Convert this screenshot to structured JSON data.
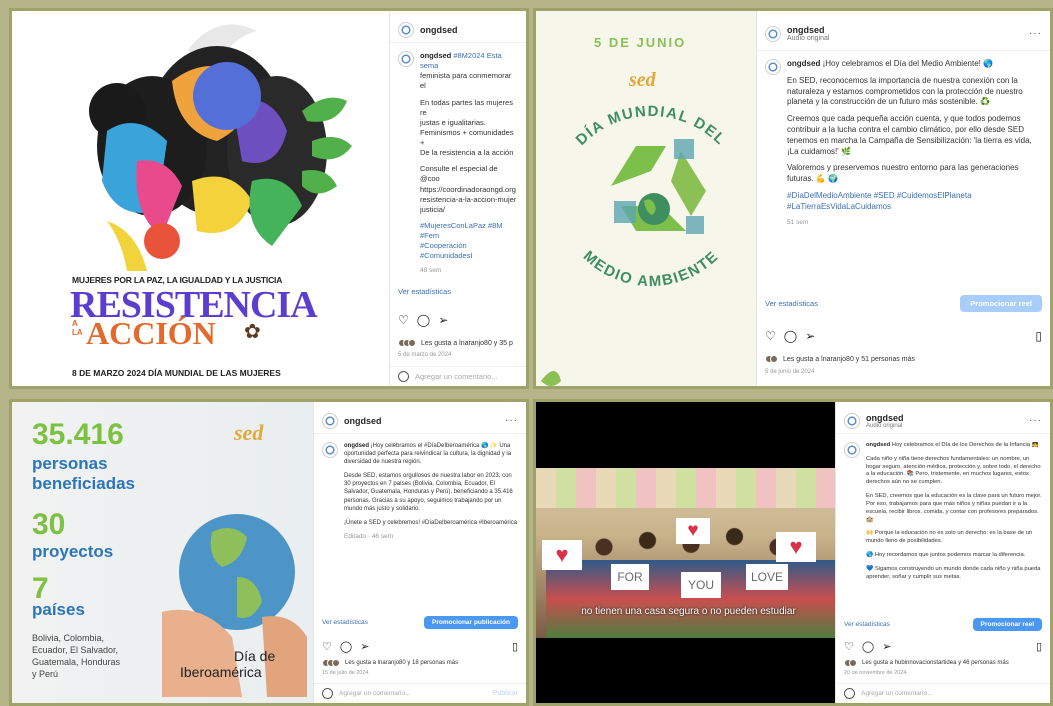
{
  "post1": {
    "username": "ongdsed",
    "caption_user": "ongdsed",
    "caption_lines": [
      "#8M2024 Esta sema",
      "feminista para conmemorar el"
    ],
    "caption_p2": [
      "En todas partes las mujeres re",
      "justas e igualitarias.",
      "Feminismos + comunidades +",
      "De la resistencia a la acción"
    ],
    "caption_p3": [
      "Consulte el especial de @coo",
      "https://coordinadoraongd.org",
      "resistencia-a-la-accion-mujer",
      "justicia/"
    ],
    "tags": [
      "#MujeresConLaPaz #8M #Fem",
      "#Cooperación #ComunidadesI"
    ],
    "time": "48 sem",
    "stats_link": "Ver estadísticas",
    "likes_text": "Les gusta a lnaranjo80 y 35 p",
    "date": "5 de marzo de 2024",
    "comment_placeholder": "Agregar un comentario...",
    "image": {
      "line1": "MUJERES POR LA PAZ, LA IGUALDAD Y LA JUSTICIA",
      "title1": "RESISTENCIA",
      "prefix": "A LA",
      "title2": "ACCIÓN",
      "footer": "8 DE MARZO 2024 DÍA MUNDIAL DE LAS MUJERES"
    }
  },
  "post2": {
    "username": "ongdsed",
    "audio": "Audio original",
    "caption_user": "ongdsed",
    "caption_first": "¡Hoy celebramos el Día del Medio Ambiente! 🌎",
    "caption_p2": "En SED, reconocemos la importancia de nuestra conexión con la naturaleza y estamos comprometidos con la protección de nuestro planeta y la construcción de un futuro más sostenible. ♻️",
    "caption_p3": "Creemos que cada pequeña acción cuenta, y que todos podemos contribuir a la lucha contra el cambio climático, por ello desde SED tenemos en marcha la Campaña de Sensibilización: 'la tierra es vida, ¡La cuidamos!' 🌿",
    "caption_p4": "Valoremos y preservemos nuestro entorno para las generaciones futuras. 💪 🌍",
    "tags": "#DíaDelMedioAmbiente #SED #CuidemosElPlaneta #LaTierraEsVidaLaCuidamos",
    "time": "51 sem",
    "stats_link": "Ver estadísticas",
    "promo_button": "Promocionar reel",
    "likes_text": "Les gusta a lnaranjo80 y 51 personas más",
    "date": "5 de junio de 2024",
    "image": {
      "date": "5 DE JUNIO",
      "logo": "sed",
      "arc_top": "DÍA MUNDIAL DEL",
      "arc_bottom": "MEDIO AMBIENTE"
    }
  },
  "post3": {
    "username": "ongdsed",
    "caption_user": "ongdsed",
    "caption_first": "¡Hoy celebramos el #DíaDeIberoamérica 🌎 ✨ Una oportunidad perfecta para reivindicar la cultura, la dignidad y la diversidad de nuestra región.",
    "caption_p2": "Desde SED, estamos orgullosos de nuestra labor en 2023, con 30 proyectos en 7 países (Bolivia, Colombia, Ecuador, El Salvador, Guatemala, Honduras y Perú), beneficiando a 35.416 personas. Gracias a su apoyo, seguimos trabajando por un mundo más justo y solidario.",
    "caption_p3": "¡Únete a SED y celebremos! #DíaDeIberoamérica #Iberoamérica",
    "time": "Editado · 46 sem",
    "stats_link": "Ver estadísticas",
    "promo_button": "Promocionar publicación",
    "likes_text": "Les gusta a lnaranjo80 y 18 personas más",
    "date": "15 de julio de 2024",
    "comment_placeholder": "Agregar un comentario...",
    "publish": "Publicar",
    "image": {
      "n1": "35.416",
      "l1a": "personas",
      "l1b": "beneficiadas",
      "n2": "30",
      "l2": "proyectos",
      "n3": "7",
      "l3": "países",
      "countries": [
        "Bolivia, Colombia,",
        "Ecuador, El Salvador,",
        "Guatemala, Honduras",
        "y Perú"
      ],
      "title1": "Día de",
      "title2": "Iberoamérica",
      "logo": "sed"
    }
  },
  "post4": {
    "username": "ongdsed",
    "audio": "Audio original",
    "caption_user": "ongdsed",
    "caption_first": "Hoy celebramos el Día de los Derechos de la Infancia 👧",
    "caption_p2": "Cada niño y niña tiene derechos fundamentales: un nombre, un hogar seguro, atención médica, protección y, sobre todo, el derecho a la educación. 📚 Pero, tristemente, en muchos lugares, estos derechos aún no se cumplen.",
    "caption_p3": "En SED, creemos que la educación es la clave para un futuro mejor. Por eso, trabajamos para que más niños y niñas puedan ir a la escuela, recibir libros, comida, y contar con profesores preparados. 🏫",
    "caption_p4": "🙌 Porque la educación no es solo un derecho: es la base de un mundo lleno de posibilidades.",
    "caption_p5": "🌎 Hoy recordamos que juntos podemos marcar la diferencia.",
    "caption_p6": "💙 Sigamos construyendo un mundo donde cada niño y niña pueda aprender, soñar y cumplir sus metas.",
    "stats_link": "Ver estadísticas",
    "promo_button": "Promocionar reel",
    "likes_text": "Les gusta a hubinnovacionstartidea y 46 personas más",
    "date": "20 de noviembre de 2024",
    "comment_placeholder": "Agregar un comentario...",
    "subtitle": "no tienen una casa segura o no pueden estudiar",
    "signs": [
      "FOR",
      "YOU",
      "LOVE"
    ]
  }
}
